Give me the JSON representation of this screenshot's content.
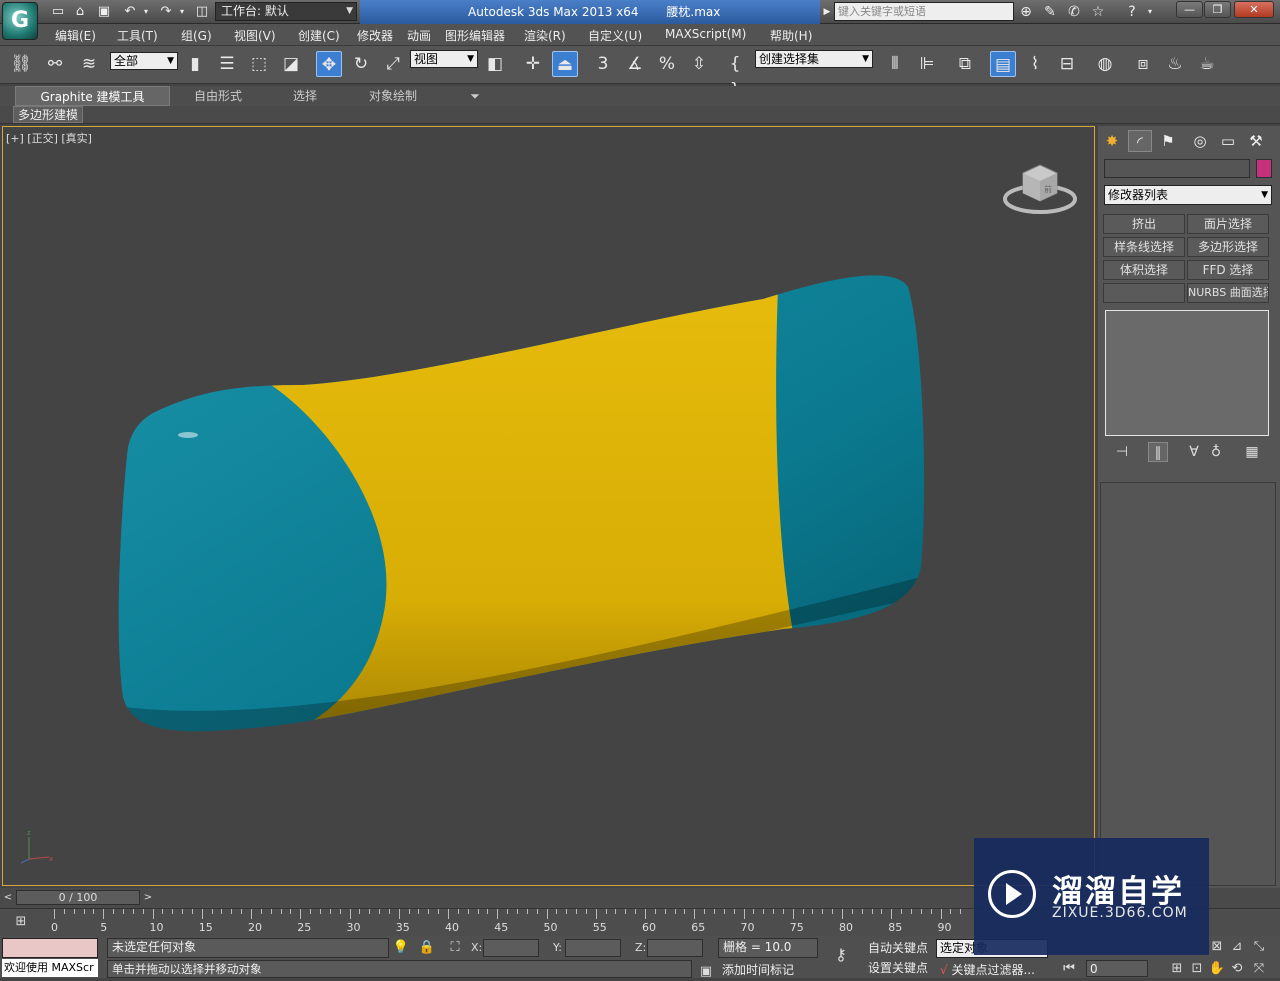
{
  "titlebar": {
    "workspace_label": "工作台: 默认",
    "app_title": "Autodesk 3ds Max  2013 x64",
    "file_name": "腰枕.max",
    "search_placeholder": "键入关键字或短语"
  },
  "menu": [
    "编辑(E)",
    "工具(T)",
    "组(G)",
    "视图(V)",
    "创建(C)",
    "修改器",
    "动画",
    "图形编辑器",
    "渲染(R)",
    "自定义(U)",
    "MAXScript(M)",
    "帮助(H)"
  ],
  "toolbar": {
    "selection_filter": "全部",
    "ref_coord": "视图",
    "named_selection": "创建选择集"
  },
  "ribbon": {
    "tabs": [
      "Graphite 建模工具",
      "自由形式",
      "选择",
      "对象绘制"
    ],
    "panel_label": "多边形建模"
  },
  "viewport": {
    "label": "[+] [正交] [真实]",
    "viewcube_text": "前"
  },
  "command_panel": {
    "modifier_list": "修改器列表",
    "buttons": [
      "挤出",
      "面片选择",
      "样条线选择",
      "多边形选择",
      "体积选择",
      "FFD 选择",
      "",
      "NURBS 曲面选择"
    ],
    "object_color": "#c4307a"
  },
  "timeline": {
    "frame_display": "0 / 100",
    "ticks": [
      "0",
      "5",
      "10",
      "15",
      "20",
      "25",
      "30",
      "35",
      "40",
      "45",
      "50",
      "55",
      "60",
      "65",
      "70",
      "75",
      "80",
      "85",
      "90"
    ]
  },
  "status": {
    "welcome": "欢迎使用 MAXScr",
    "selection_status": "未选定任何对象",
    "prompt": "单击并拖动以选择并移动对象",
    "x_label": "X:",
    "y_label": "Y:",
    "z_label": "Z:",
    "grid": "栅格 = 10.0",
    "auto_key": "自动关键点",
    "set_key": "设置关键点",
    "selected_dd": "选定对象",
    "add_time_tag": "添加时间标记",
    "key_filters": "关键点过滤器...",
    "frame_field": "0"
  },
  "watermark": {
    "title": "溜溜自学",
    "url": "ZIXUE.3D66.COM"
  },
  "colors": {
    "pillow_teal": "#0c7f95",
    "pillow_yellow": "#dcb106",
    "viewport_bg": "#444444",
    "viewport_border": "#d4a83a"
  }
}
